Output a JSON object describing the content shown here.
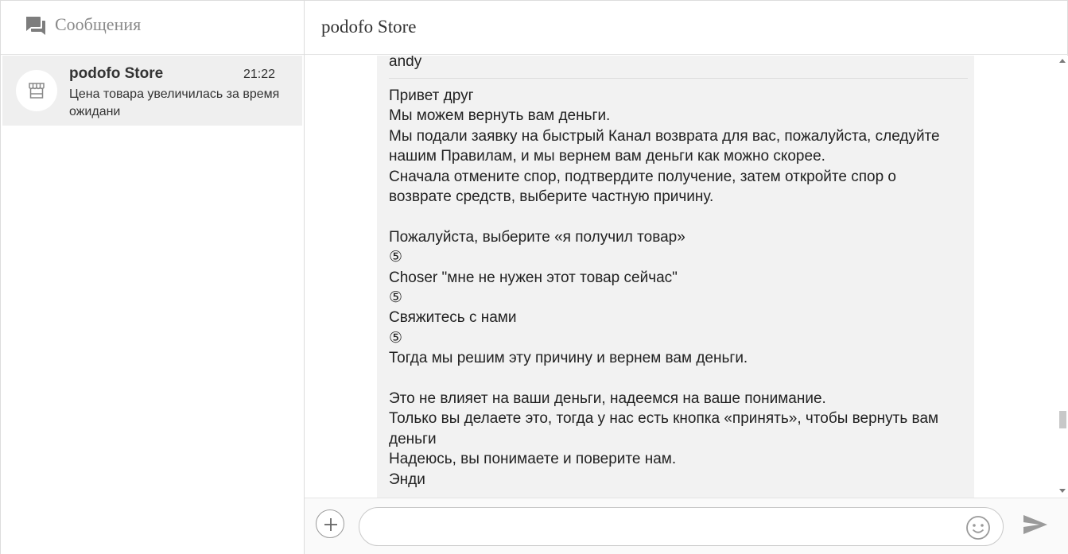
{
  "sidebar": {
    "title": "Сообщения",
    "header_icon": "chat-bubbles-icon",
    "conversations": [
      {
        "name": "podofo Store",
        "time": "21:22",
        "preview": "Цена товара увеличилась за время ожидани",
        "avatar_icon": "store-icon"
      }
    ]
  },
  "chat": {
    "title": "podofo Store",
    "message": {
      "author": "andy",
      "lines": [
        "Привет друг",
        "Мы можем вернуть вам деньги.",
        "Мы подали заявку на быстрый Канал возврата для вас, пожалуйста, следуйте",
        "нашим Правилам, и мы вернем вам деньги как можно скорее.",
        "Сначала отмените спор, подтвердите получение, затем откройте спор о",
        "возврате средств, выберите частную причину.",
        "",
        "Пожалуйста, выберите «я получил товар»",
        "⑤",
        "Choser \"мне не нужен этот товар сейчас\"",
        "⑤",
        "Свяжитесь с нами",
        "⑤",
        "Тогда мы решим эту причину и вернем вам деньги.",
        "",
        "Это не влияет на ваши деньги, надеемся на ваше понимание.",
        "Только вы делаете это, тогда у нас есть кнопка «принять», чтобы вернуть вам",
        "деньги",
        "Надеюсь, вы понимаете и поверите нам.",
        "Энди"
      ]
    }
  },
  "composer": {
    "input_value": "",
    "input_placeholder": "",
    "add_icon": "plus-icon",
    "emoji_icon": "smiley-icon",
    "send_icon": "send-icon"
  },
  "colors": {
    "selected_conversation_bg": "#efefef",
    "bubble_bg": "#f2f2f2",
    "muted_text": "#8a8a8a"
  }
}
